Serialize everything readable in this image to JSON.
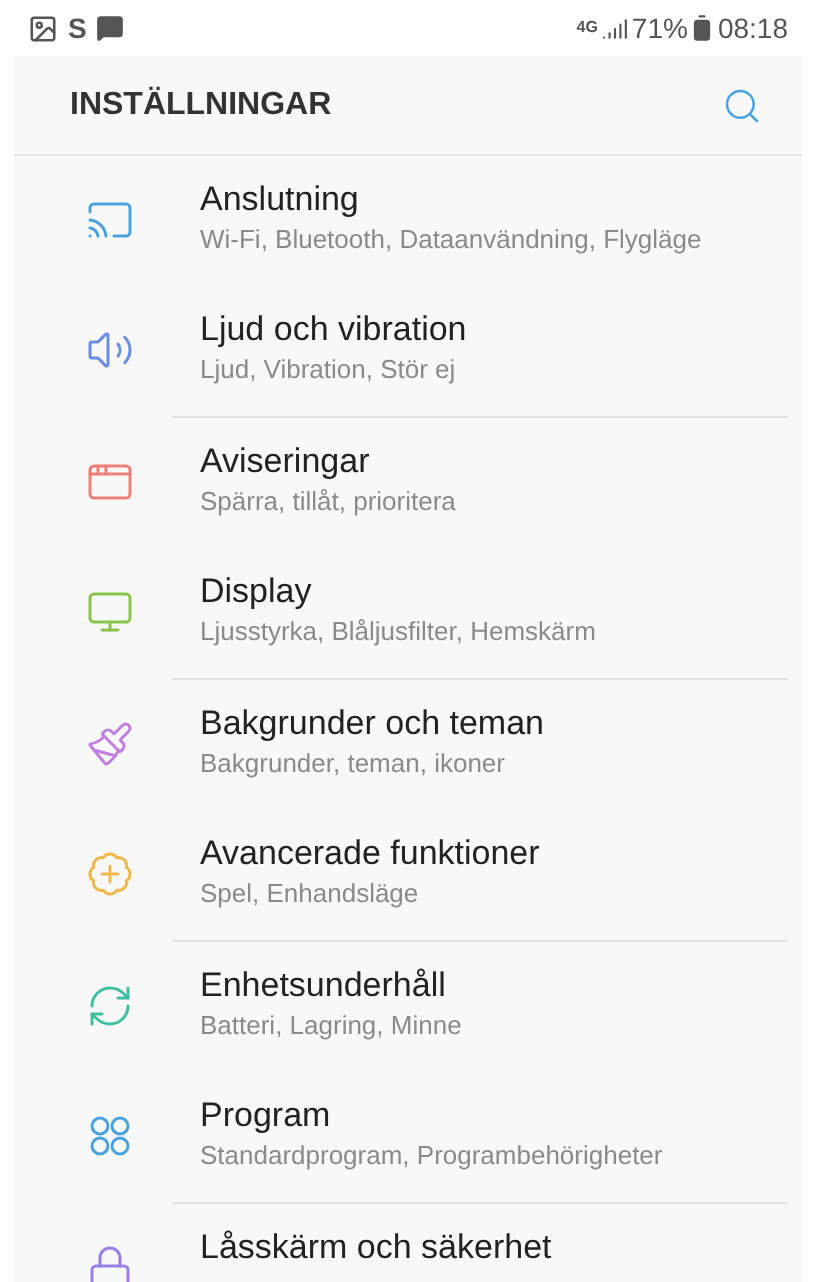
{
  "status_bar": {
    "app_glyph": "S",
    "network": "4G",
    "battery": "71%",
    "time": "08:18"
  },
  "header": {
    "title": "INSTÄLLNINGAR"
  },
  "groups": [
    {
      "items": [
        {
          "kind": "connections",
          "color": "#4aa3df",
          "title": "Anslutning",
          "subtitle": "Wi-Fi, Bluetooth, Dataanvändning, Flygläge"
        },
        {
          "kind": "sound",
          "color": "#6b8de3",
          "title": "Ljud och vibration",
          "subtitle": "Ljud, Vibration, Stör ej"
        }
      ]
    },
    {
      "items": [
        {
          "kind": "notifications",
          "color": "#f07f7a",
          "title": "Aviseringar",
          "subtitle": "Spärra, tillåt, prioritera"
        },
        {
          "kind": "display",
          "color": "#8bc34a",
          "title": "Display",
          "subtitle": "Ljusstyrka, Blåljusfilter, Hemskärm"
        }
      ]
    },
    {
      "items": [
        {
          "kind": "wallpaper",
          "color": "#c17fe0",
          "title": "Bakgrunder och teman",
          "subtitle": "Bakgrunder, teman, ikoner"
        },
        {
          "kind": "advanced",
          "color": "#f0b84a",
          "title": "Avancerade funktioner",
          "subtitle": "Spel, Enhandsläge"
        }
      ]
    },
    {
      "items": [
        {
          "kind": "maintenance",
          "color": "#3fbf9f",
          "title": "Enhetsunderhåll",
          "subtitle": "Batteri, Lagring, Minne"
        },
        {
          "kind": "apps",
          "color": "#4aa3df",
          "title": "Program",
          "subtitle": "Standardprogram, Programbehörigheter"
        }
      ]
    },
    {
      "items": [
        {
          "kind": "lock",
          "color": "#9a7fe8",
          "title": "Låsskärm och säkerhet"
        }
      ]
    }
  ]
}
